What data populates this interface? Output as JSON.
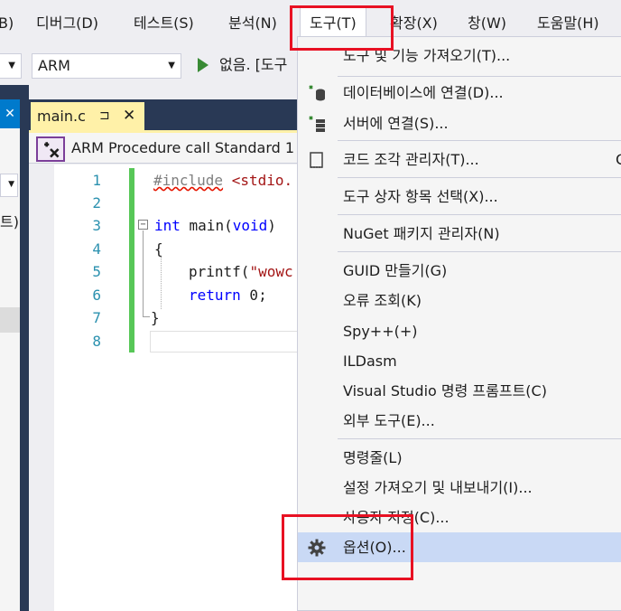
{
  "menubar": {
    "items": [
      {
        "label": "B)"
      },
      {
        "label": "디버그(D)"
      },
      {
        "label": "테스트(S)"
      },
      {
        "label": "분석(N)"
      },
      {
        "label": "도구(T)"
      },
      {
        "label": "확장(X)"
      },
      {
        "label": "창(W)"
      },
      {
        "label": "도움말(H)"
      }
    ]
  },
  "toolbar": {
    "platform_value": "ARM",
    "run_label": "없음. [도구"
  },
  "left_pane": {
    "close_glyph": "✕",
    "text": "트)"
  },
  "editor": {
    "tab_label": "main.c",
    "tab_pin": "⊐",
    "tab_close": "✕",
    "nav_label": "ARM Procedure call Standard 1",
    "line_numbers": [
      "1",
      "2",
      "3",
      "4",
      "5",
      "6",
      "7",
      "8"
    ],
    "code": {
      "line1_directive": "#include",
      "line1_rest": " <stdio.",
      "line3_kw": "int",
      "line3_rest": " main(",
      "line3_kw2": "void",
      "line3_close": ")",
      "line4": "{",
      "line5_func": "printf(",
      "line5_str": "\"wowc",
      "line6_kw": "return",
      "line6_rest": " 0;",
      "line7": "}"
    },
    "fold_glyph": "−"
  },
  "tools_menu": {
    "items": [
      {
        "label": "도구 및 기능 가져오기(T)..."
      },
      {
        "label": "데이터베이스에 연결(D)..."
      },
      {
        "label": "서버에 연결(S)..."
      },
      {
        "label": "코드 조각 관리자(T)...",
        "shortcut": "C"
      },
      {
        "label": "도구 상자 항목 선택(X)..."
      },
      {
        "label": "NuGet 패키지 관리자(N)"
      },
      {
        "label": "GUID 만들기(G)"
      },
      {
        "label": "오류 조회(K)"
      },
      {
        "label": "Spy++(+)"
      },
      {
        "label": "ILDasm"
      },
      {
        "label": "Visual Studio 명령 프롬프트(C)"
      },
      {
        "label": "외부 도구(E)..."
      },
      {
        "label": "명령줄(L)"
      },
      {
        "label": "설정 가져오기 및 내보내기(I)..."
      },
      {
        "label": "사용자 지정(C)..."
      },
      {
        "label": "옵션(O)..."
      }
    ]
  },
  "colors": {
    "accent_blue": "#007acc",
    "hover_blue": "#c9d9f5",
    "annotation_red": "#e81123",
    "run_green": "#388a34"
  }
}
